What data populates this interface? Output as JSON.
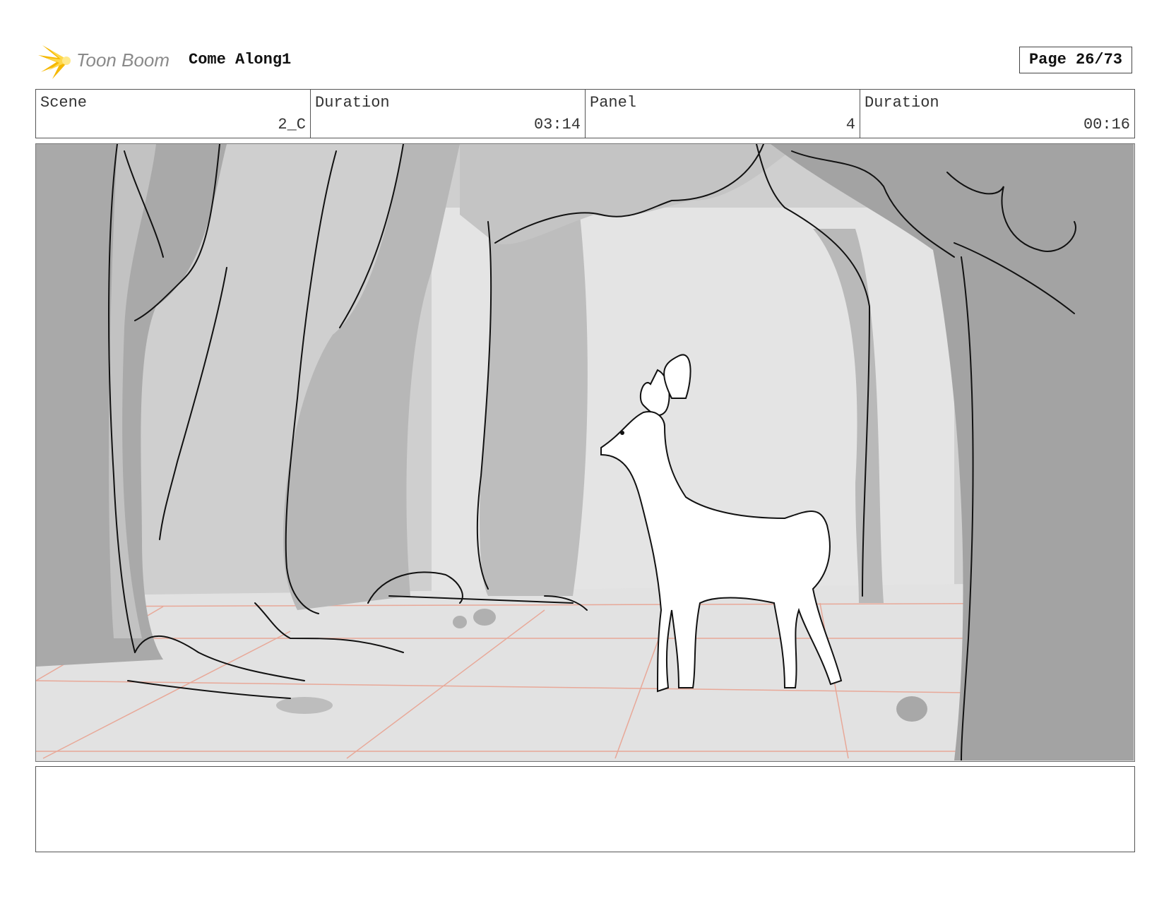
{
  "header": {
    "logo_text": "Toon Boom",
    "project_title": "Come Along1",
    "page_label": "Page 26/73"
  },
  "info": {
    "scene_label": "Scene",
    "scene_value": "2_C",
    "scene_duration_label": "Duration",
    "scene_duration_value": "03:14",
    "panel_label": "Panel",
    "panel_value": "4",
    "panel_duration_label": "Duration",
    "panel_duration_value": "00:16"
  },
  "panel": {
    "image_icon": "storyboard-sketch-forest-deer"
  },
  "notes": {
    "text": ""
  }
}
